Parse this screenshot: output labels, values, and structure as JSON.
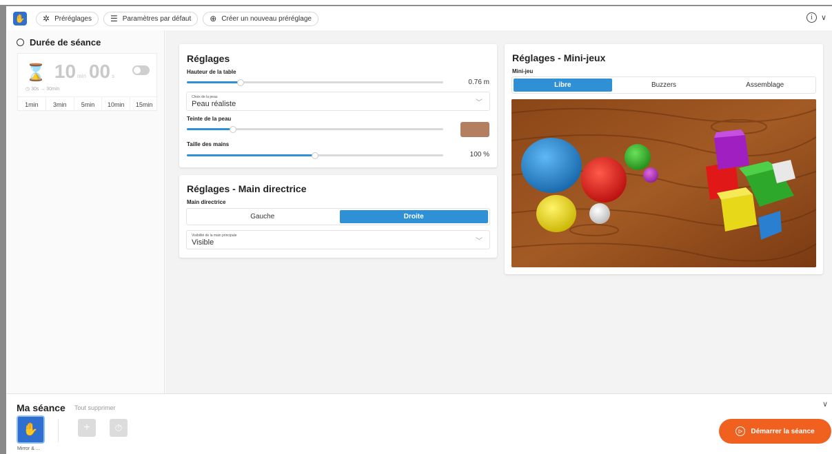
{
  "toolbar": {
    "prereglages": "Préréglages",
    "parametres": "Paramètres par défaut",
    "creer": "Créer un nouveau préréglage"
  },
  "duree": {
    "title": "Durée de séance",
    "minutes": "10",
    "min_unit": "min",
    "seconds": "00",
    "sec_unit": "s",
    "range": "30s → 30min",
    "presets": [
      "1min",
      "3min",
      "5min",
      "10min",
      "15min"
    ]
  },
  "reglages": {
    "title": "Réglages",
    "hauteur_label": "Hauteur de la table",
    "hauteur_value": "0.76 m",
    "hauteur_fraction": 0.21,
    "peau_small": "Choix de la peau",
    "peau_value": "Peau réaliste",
    "teinte_label": "Teinte de la peau",
    "teinte_fraction": 0.18,
    "teinte_color": "#b47e61",
    "taille_label": "Taille des mains",
    "taille_value": "100 %",
    "taille_fraction": 0.5
  },
  "main_directrice": {
    "title": "Réglages - Main directrice",
    "label": "Main directrice",
    "options": [
      "Gauche",
      "Droite"
    ],
    "selected": "Droite",
    "visibilite_small": "Visibilité de la main principale",
    "visibilite_value": "Visible"
  },
  "mini_jeux": {
    "title": "Réglages - Mini-jeux",
    "label": "Mini-jeu",
    "options": [
      "Libre",
      "Buzzers",
      "Assemblage"
    ],
    "selected": "Libre"
  },
  "bottom": {
    "ma_seance": "Ma séance",
    "tout_supprimer": "Tout supprimer",
    "thumb_label": "Mirror & ...",
    "start": "Démarrer la séance"
  },
  "colors": {
    "accent": "#2f90d6",
    "start": "#f0601f"
  }
}
